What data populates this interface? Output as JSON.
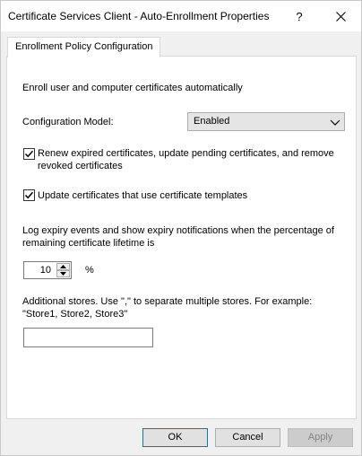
{
  "window": {
    "title": "Certificate Services Client - Auto-Enrollment Properties",
    "help_glyph": "?",
    "close_icon": "close-icon"
  },
  "tabs": [
    {
      "label": "Enrollment Policy Configuration",
      "selected": true
    }
  ],
  "panel": {
    "heading": "Enroll user and computer certificates automatically",
    "config_model": {
      "label": "Configuration Model:",
      "value": "Enabled"
    },
    "renew_checkbox": {
      "label": "Renew expired certificates, update pending certificates, and remove revoked certificates",
      "checked": true
    },
    "update_checkbox": {
      "label": "Update certificates that use certificate templates",
      "checked": true
    },
    "expiry_text": "Log expiry events and show expiry notifications when the percentage of remaining certificate lifetime is",
    "percentage": {
      "value": "10",
      "unit": "%"
    },
    "stores_text": "Additional stores. Use \",\" to separate multiple stores. For example: \"Store1, Store2, Store3\"",
    "stores_input": {
      "value": ""
    }
  },
  "buttons": {
    "ok": "OK",
    "cancel": "Cancel",
    "apply": "Apply"
  },
  "colors": {
    "window_bg": "#f0f0f0",
    "panel_bg": "#ffffff",
    "default_button_border": "#0078d7",
    "disabled_text": "#838383"
  }
}
